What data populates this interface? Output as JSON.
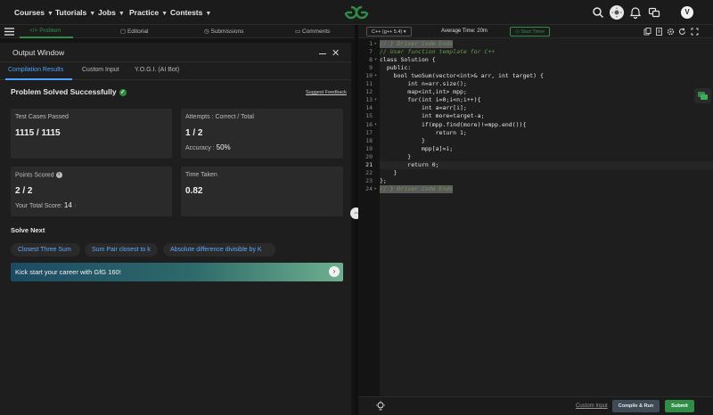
{
  "nav": {
    "items": [
      {
        "label": "Courses"
      },
      {
        "label": "Tutorials"
      },
      {
        "label": "Jobs"
      },
      {
        "label": "Practice"
      },
      {
        "label": "Contests"
      }
    ],
    "avatar_letter": "V",
    "brand_color": "#2f8d46"
  },
  "problem_tabs": {
    "problem": "</> Problem",
    "editorial": "Editorial",
    "submissions": "Submissions",
    "comments": "Comments"
  },
  "output": {
    "title": "Output Window",
    "tabs": {
      "compilation": "Compilation Results",
      "custom_input": "Custom Input",
      "yogi": "Y.O.G.I. (AI Bot)"
    },
    "status": "Problem Solved Successfully",
    "feedback": "Suggest Feedback",
    "cards": {
      "test_cases": {
        "label": "Test Cases Passed",
        "value": "1115 / 1115"
      },
      "attempts": {
        "label": "Attempts : Correct / Total",
        "value": "1 / 2",
        "accuracy_label": "Accuracy :",
        "accuracy_value": "50%"
      },
      "points": {
        "label": "Points Scored",
        "value": "2 / 2",
        "total_label": "Your Total Score:",
        "total_value": "14"
      },
      "time": {
        "label": "Time Taken",
        "value": "0.82"
      }
    },
    "solve_next": {
      "heading": "Solve Next",
      "items": [
        "Closest Three Sum",
        "Sum Pair closest to k",
        "Absolute difference divisible by K"
      ]
    },
    "banner": "Kick start your career with GfG 160!"
  },
  "editor": {
    "language": "C++ (g++ 5.4)",
    "avg_time": "Average Time: 20m",
    "timer": "Start Timer",
    "current_line": 21,
    "lines": [
      {
        "n": "1",
        "fold": "▸",
        "text": "// } Driver Code Ends",
        "style": "hlcmt"
      },
      {
        "n": "7",
        "fold": "",
        "text": "// User function template for C++",
        "style": "cmt"
      },
      {
        "n": "8",
        "fold": "▾",
        "text": "class Solution {",
        "style": "code"
      },
      {
        "n": "9",
        "fold": "",
        "text": "  public:",
        "style": "code"
      },
      {
        "n": "10",
        "fold": "▾",
        "text": "    bool twoSum(vector<int>& arr, int target) {",
        "style": "code"
      },
      {
        "n": "11",
        "fold": "",
        "text": "        int n=arr.size();",
        "style": "code"
      },
      {
        "n": "12",
        "fold": "",
        "text": "        map<int,int> mpp;",
        "style": "code"
      },
      {
        "n": "13",
        "fold": "▾",
        "text": "        for(int i=0;i<n;i++){",
        "style": "code"
      },
      {
        "n": "14",
        "fold": "",
        "text": "            int a=arr[i];",
        "style": "code"
      },
      {
        "n": "15",
        "fold": "",
        "text": "            int more=target-a;",
        "style": "code"
      },
      {
        "n": "16",
        "fold": "▾",
        "text": "            if(mpp.find(more)!=mpp.end()){",
        "style": "code"
      },
      {
        "n": "17",
        "fold": "",
        "text": "                return 1;",
        "style": "code"
      },
      {
        "n": "18",
        "fold": "",
        "text": "            }",
        "style": "code"
      },
      {
        "n": "19",
        "fold": "",
        "text": "            mpp[a]=i;",
        "style": "code"
      },
      {
        "n": "20",
        "fold": "",
        "text": "        }",
        "style": "code"
      },
      {
        "n": "21",
        "fold": "",
        "text": "        return 0;",
        "style": "code"
      },
      {
        "n": "22",
        "fold": "",
        "text": "    }",
        "style": "code"
      },
      {
        "n": "23",
        "fold": "",
        "text": "};",
        "style": "code"
      },
      {
        "n": "24",
        "fold": "▸",
        "text": "// } Driver Code Ends",
        "style": "hlcmt"
      }
    ]
  },
  "bottom": {
    "custom_input": "Custom Input",
    "compile_run": "Compile & Run",
    "submit": "Submit"
  }
}
